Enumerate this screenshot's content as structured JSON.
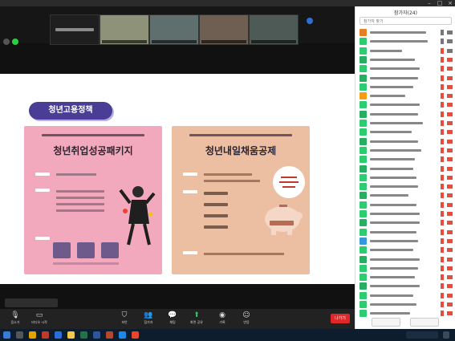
{
  "slide": {
    "badge": "청년고용정책",
    "posterA": {
      "title": "청년취업성공패키지"
    },
    "posterB": {
      "title": "청년내일채움공제"
    }
  },
  "toolbar": {
    "items": [
      {
        "label": "음소거",
        "icon": "mic-icon"
      },
      {
        "label": "비디오 시작",
        "icon": "video-icon"
      },
      {
        "label": "보안",
        "icon": "shield-icon"
      },
      {
        "label": "참가자",
        "icon": "participants-icon"
      },
      {
        "label": "채팅",
        "icon": "chat-icon"
      },
      {
        "label": "화면 공유",
        "icon": "share-screen-icon"
      },
      {
        "label": "기록",
        "icon": "record-icon"
      },
      {
        "label": "반응",
        "icon": "reaction-icon"
      }
    ],
    "leave": "나가기"
  },
  "panel": {
    "title": "참가자(24)",
    "search_placeholder": "참가자 찾기"
  },
  "colors": {
    "accent": "#4a3d95",
    "leave": "#e02828",
    "posterA": "#f3a9bd",
    "posterB": "#edbfa2"
  }
}
